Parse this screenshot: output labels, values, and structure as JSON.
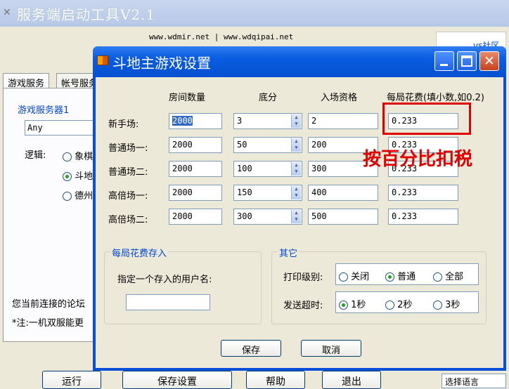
{
  "bg_window": {
    "title": "服务端启动工具V2.1",
    "urls": "www.wdmir.net  |  www.wdqipai.net",
    "tabs": [
      "游戏服务",
      "帐号服务"
    ],
    "group_title": "游戏服务器1",
    "ip_value": "Any",
    "logic_label": "逻辑:",
    "logic_options": [
      "象棋",
      "斗地",
      "德州"
    ],
    "note1": "您当前连接的论坛",
    "note2": "*注:一机双服能更",
    "buttons": [
      "运行",
      "保存设置",
      "帮助",
      "退出"
    ],
    "lang_label": "选择语言",
    "right_text": "vs社区"
  },
  "dialog": {
    "title": "斗地主游戏设置",
    "columns": [
      "房间数量",
      "底分",
      "入场资格",
      "每局花费(填小数,如0.2)"
    ],
    "rows": [
      {
        "name": "新手场:",
        "rooms": "2000",
        "base": "3",
        "entry": "2",
        "fee": "0.233"
      },
      {
        "name": "普通场一:",
        "rooms": "2000",
        "base": "50",
        "entry": "200",
        "fee": "0.233"
      },
      {
        "name": "普通场二:",
        "rooms": "2000",
        "base": "100",
        "entry": "300",
        "fee": "0.233"
      },
      {
        "name": "高倍场一:",
        "rooms": "2000",
        "base": "150",
        "entry": "400",
        "fee": "0.233"
      },
      {
        "name": "高倍场二:",
        "rooms": "2000",
        "base": "300",
        "entry": "500",
        "fee": "0.233"
      }
    ],
    "fee_group": {
      "title": "每局花费存入",
      "label": "指定一个存入的用户名:",
      "value": ""
    },
    "other_group": {
      "title": "其它",
      "print_label": "打印级别:",
      "print_options": [
        "关闭",
        "普通",
        "全部"
      ],
      "print_selected": 1,
      "timeout_label": "发送超时:",
      "timeout_options": [
        "1秒",
        "2秒",
        "3秒"
      ],
      "timeout_selected": 0
    },
    "save_label": "保存",
    "cancel_label": "取消"
  },
  "annotation": "按百分比扣税",
  "colors": {
    "accent": "#0a4fd6",
    "annotation": "#e00000",
    "group_title": "#0046d5"
  }
}
